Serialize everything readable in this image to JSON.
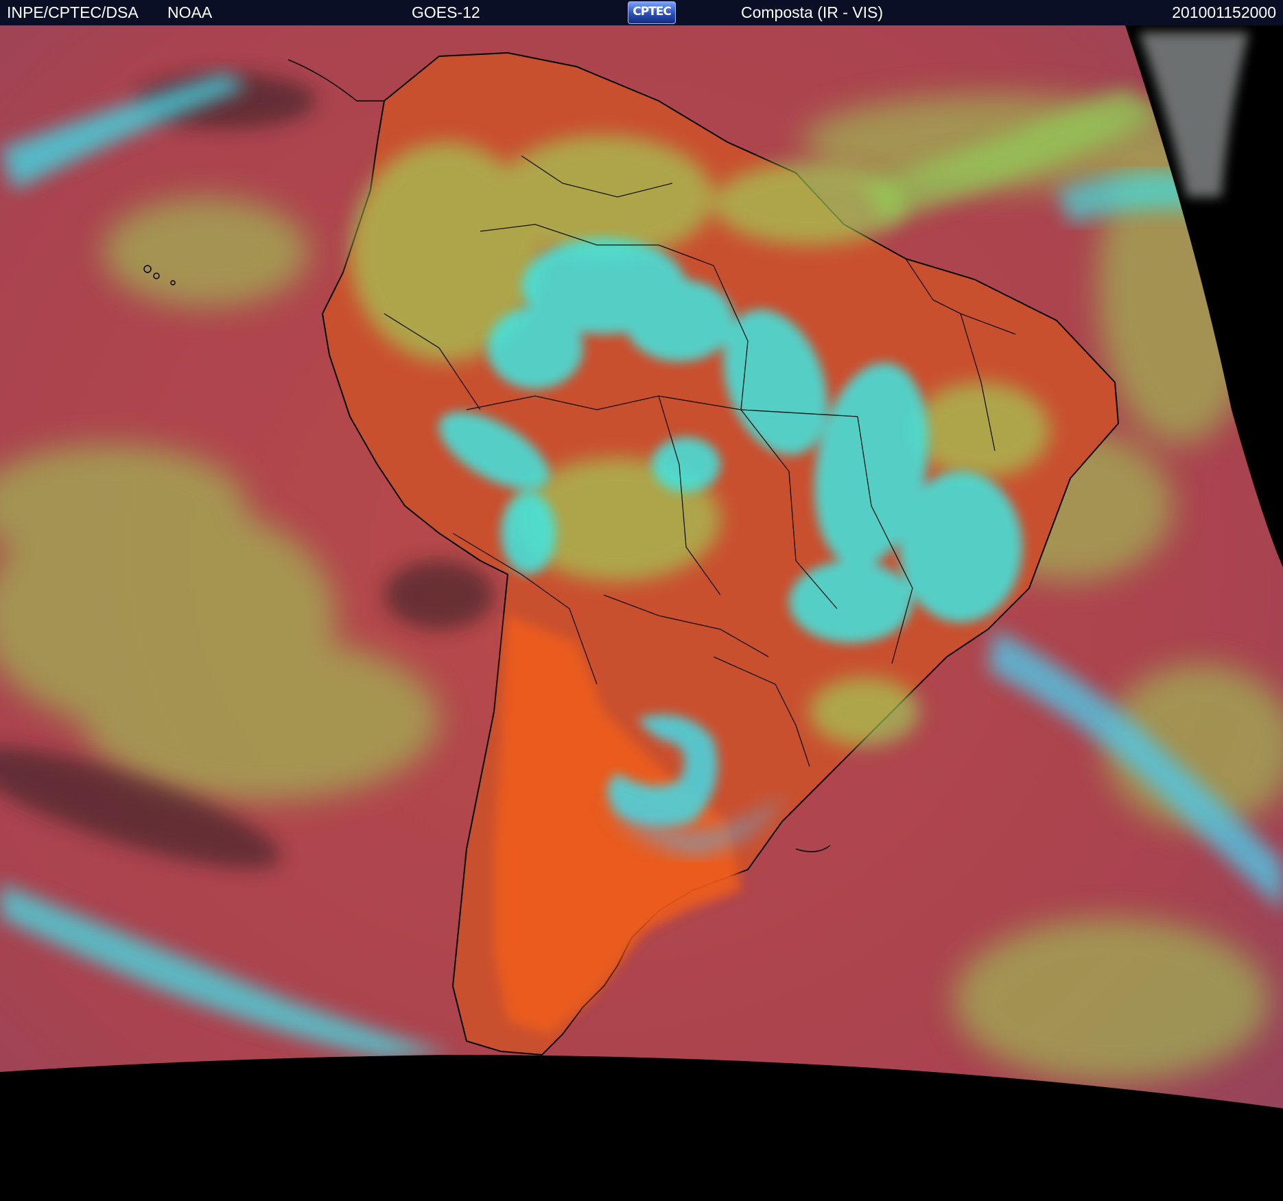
{
  "header": {
    "organization": "INPE/CPTEC/DSA",
    "agency": "NOAA",
    "satellite": "GOES-12",
    "logo_text": "CPTEC",
    "product": "Composta (IR - VIS)",
    "timestamp": "201001152000"
  },
  "colors": {
    "header_bg": "#0b0f26",
    "ocean_clear": "#b0464d",
    "land_clear": "#e05a2a",
    "low_cloud": "#9ed456",
    "high_cloud": "#35e5e0",
    "space": "#000000",
    "coastline": "#000000"
  }
}
